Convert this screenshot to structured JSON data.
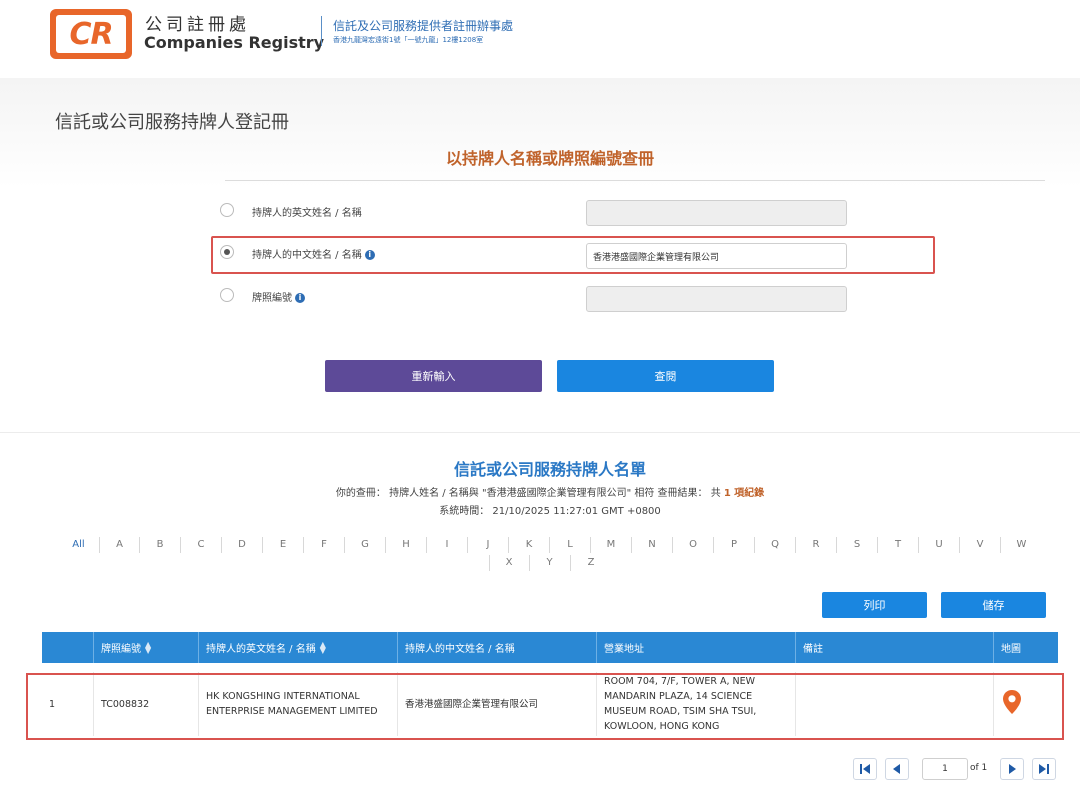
{
  "header": {
    "logo": "CR",
    "org_zh": "公司註冊處",
    "org_en": "Companies Registry",
    "dept_zh": "信託及公司服務提供者註冊辦事處",
    "dept_addr": "香港九龍灣宏遠街1號「一號九龍」12樓1208室"
  },
  "page": {
    "title": "信託或公司服務持牌人登記冊"
  },
  "search": {
    "title": "以持牌人名稱或牌照編號查冊",
    "options": [
      {
        "label": "持牌人的英文姓名 / 名稱",
        "checked": false,
        "value": ""
      },
      {
        "label": "持牌人的中文姓名 / 名稱",
        "checked": true,
        "value": "香港港盛國際企業管理有限公司"
      },
      {
        "label": "牌照編號",
        "checked": false,
        "value": ""
      }
    ],
    "reset_label": "重新輸入",
    "search_label": "查閱"
  },
  "results": {
    "title": "信託或公司服務持牌人名單",
    "query_prefix": "你的查冊： 持牌人姓名 / 名稱與 \"香港港盛國際企業管理有限公司\" 相符 查冊結果： 共",
    "query_count": "1",
    "query_suffix": "項紀錄",
    "system_time": "系統時間： 21/10/2025 11:27:01 GMT +0800",
    "alpha_all": "All",
    "alpha_row1": [
      "A",
      "B",
      "C",
      "D",
      "E",
      "F",
      "G",
      "H",
      "I",
      "J",
      "K",
      "L",
      "M",
      "N",
      "O",
      "P",
      "Q",
      "R",
      "S",
      "T",
      "U",
      "V",
      "W"
    ],
    "alpha_row2": [
      "X",
      "Y",
      "Z"
    ],
    "print_label": "列印",
    "save_label": "儲存",
    "columns": [
      "",
      "牌照編號",
      "持牌人的英文姓名 / 名稱",
      "持牌人的中文姓名 / 名稱",
      "營業地址",
      "備註",
      "地圖"
    ],
    "rows": [
      {
        "index": "1",
        "licence_no": "TC008832",
        "name_en": "HK KONGSHING INTERNATIONAL ENTERPRISE MANAGEMENT LIMITED",
        "name_zh": "香港港盛國際企業管理有限公司",
        "address": "ROOM 704, 7/F, TOWER A, NEW MANDARIN PLAZA, 14 SCIENCE MUSEUM ROAD, TSIM SHA TSUI, KOWLOON, HONG KONG",
        "remarks": ""
      }
    ],
    "pagination": {
      "current": "1",
      "of": "of 1"
    }
  },
  "icons": {
    "map": "map-pin-icon",
    "info": "info-icon",
    "first": "first-page-icon",
    "prev": "prev-page-icon",
    "next": "next-page-icon",
    "last": "last-page-icon"
  },
  "colors": {
    "brand_orange": "#e8662a",
    "primary_blue": "#1a86e0",
    "reset_purple": "#5d4a98",
    "highlight_red": "#d9534f",
    "table_header": "#2a88d4"
  }
}
